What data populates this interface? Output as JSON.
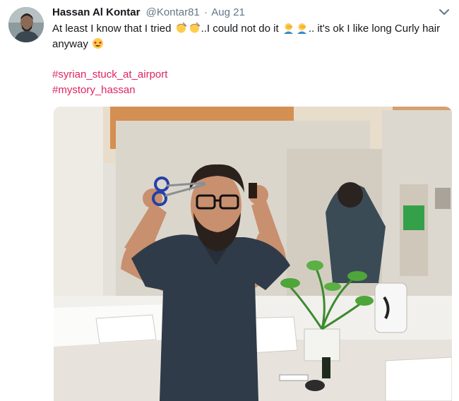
{
  "tweet": {
    "author_name": "Hassan Al Kontar",
    "handle": "@Kontar81",
    "separator": "·",
    "date": "Aug 21",
    "text_part1": "At least I know that I tried",
    "text_part2": "..I could not do it",
    "text_part3": ".. it's ok I like long Curly hair anyway",
    "hashtags": [
      "#syrian_stuck_at_airport",
      "#mystory_hassan"
    ],
    "emojis": [
      "haircut-emoji",
      "haircut-emoji",
      "facepalm-emoji",
      "facepalm-emoji",
      "heart-eyes-emoji"
    ],
    "photo_description_icon": "photo"
  },
  "colors": {
    "hashtag": "#e0245e",
    "meta": "#657786",
    "text": "#14171a"
  }
}
